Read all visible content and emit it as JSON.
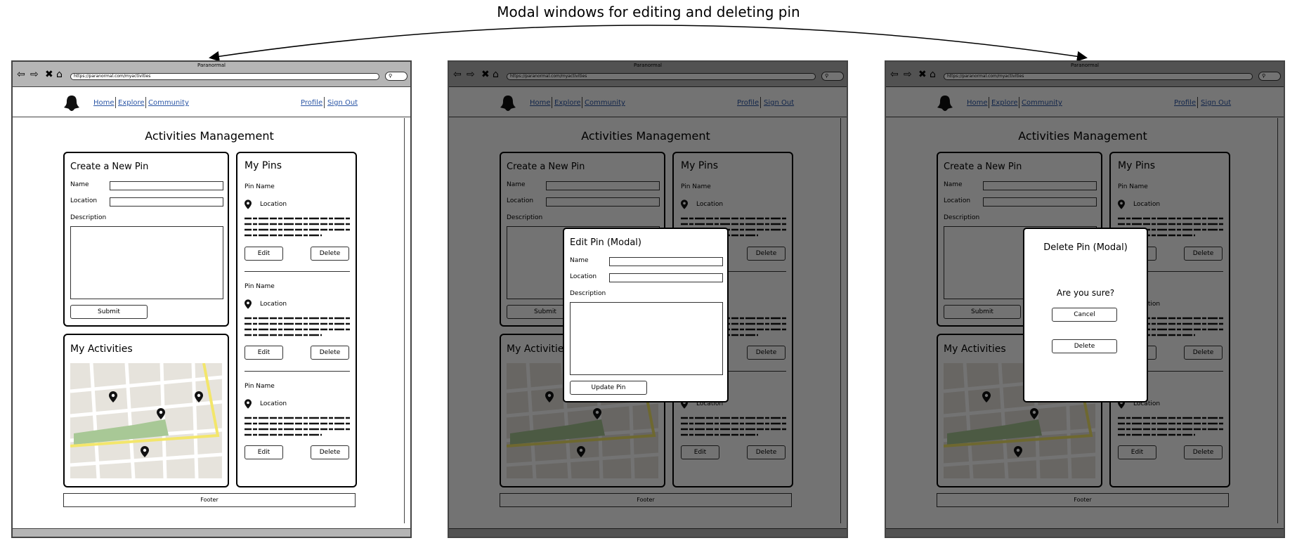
{
  "title": "Modal windows for editing and deleting pin",
  "browser": {
    "window_title": "Paranormal",
    "url": "https://paranormal.com/myactivities"
  },
  "nav": {
    "home": "Home",
    "explore": "Explore",
    "community": "Community",
    "profile": "Profile",
    "sign_out": "Sign Out"
  },
  "page": {
    "heading": "Activities Management",
    "footer": "Footer"
  },
  "create_pin": {
    "title": "Create a New Pin",
    "name_label": "Name",
    "location_label": "Location",
    "description_label": "Description",
    "submit": "Submit"
  },
  "my_activities": {
    "title": "My Activities"
  },
  "my_pins": {
    "title": "My Pins",
    "items": [
      {
        "name": "Pin Name",
        "location": "Location",
        "edit": "Edit",
        "delete": "Delete"
      },
      {
        "name": "Pin Name",
        "location": "Location",
        "edit": "Edit",
        "delete": "Delete"
      },
      {
        "name": "Pin Name",
        "location": "Location",
        "edit": "Edit",
        "delete": "Delete"
      }
    ]
  },
  "edit_modal": {
    "title": "Edit Pin (Modal)",
    "name_label": "Name",
    "location_label": "Location",
    "description_label": "Description",
    "update": "Update Pin"
  },
  "delete_modal": {
    "title": "Delete Pin (Modal)",
    "question": "Are you sure?",
    "cancel": "Cancel",
    "delete": "Delete"
  },
  "colors": {
    "link": "#2a55a5",
    "chrome": "#b5b5b5",
    "map_park": "#a8c896",
    "map_road": "#f3e66b",
    "overlay": "rgba(0,0,0,0.55)"
  }
}
